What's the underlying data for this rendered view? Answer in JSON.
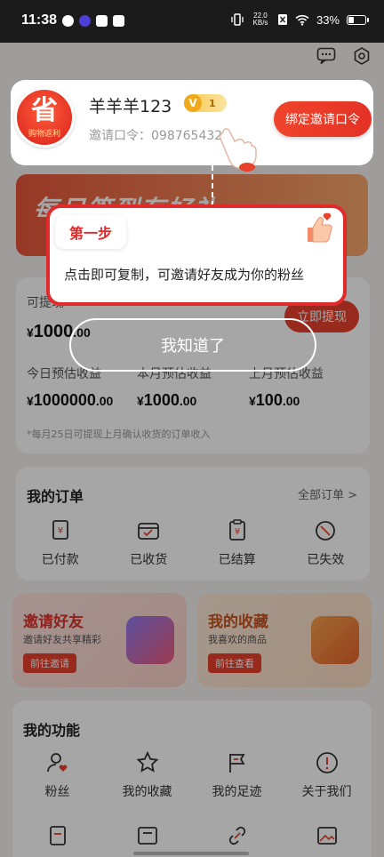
{
  "status_bar": {
    "time": "11:38",
    "net_speed_value": "22.0",
    "net_speed_unit": "KB/s",
    "battery": "33%",
    "battery_level": 0.33
  },
  "profile": {
    "avatar_text": "省",
    "avatar_subtext": "购物返利",
    "username": "羊羊羊123",
    "vip_badge": "V",
    "vip_level": "1",
    "invite_label": "邀请口令：",
    "invite_code": "098765432",
    "bind_button": "绑定邀请口令"
  },
  "banner": {
    "title": "每日签到有好礼"
  },
  "guide": {
    "step_label": "第一步",
    "text": "点击即可复制，可邀请好友成为你的粉丝",
    "got_it": "我知道了"
  },
  "earnings": {
    "withdrawable_label": "可提现",
    "withdrawable_value": "1000",
    "withdrawable_cents": ".00",
    "currency": "¥",
    "withdraw_button": "立即提现",
    "today_label": "今日预估收益",
    "today_value": "1000000",
    "today_cents": ".00",
    "month_label": "本月预估收益",
    "month_value": "1000",
    "month_cents": ".00",
    "last_month_label": "上月预估收益",
    "last_month_value": "100",
    "last_month_cents": ".00",
    "note": "*每月25日可提现上月确认收货的订单收入"
  },
  "orders": {
    "title": "我的订单",
    "all": "全部订单 >",
    "items": [
      "已付款",
      "已收货",
      "已结算",
      "已失效"
    ]
  },
  "promos": {
    "invite_title": "邀请好友",
    "invite_sub": "邀请好友共享精彩",
    "invite_btn": "前往邀请",
    "fav_title": "我的收藏",
    "fav_sub": "我喜欢的商品",
    "fav_btn": "前往查看"
  },
  "functions": {
    "title": "我的功能",
    "items": [
      "粉丝",
      "我的收藏",
      "我的足迹",
      "关于我们"
    ]
  },
  "colors": {
    "accent": "#e8412c",
    "guide_border": "#e12a2a"
  }
}
